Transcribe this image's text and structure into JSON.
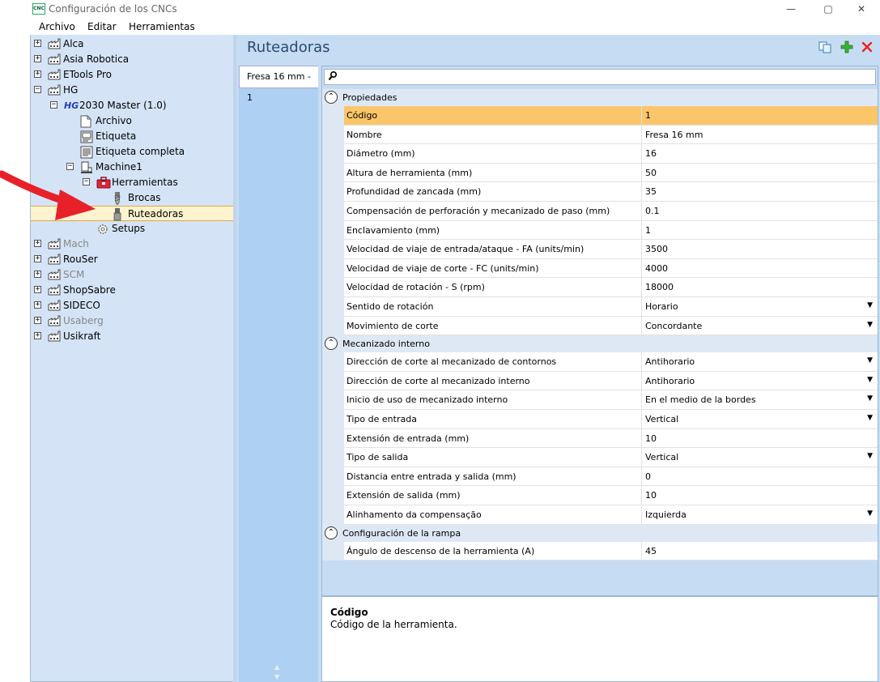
{
  "window": {
    "title": "Configuración de los CNCs",
    "icon_text": "CNC",
    "minimize": "—",
    "maximize": "▢",
    "close": "✕"
  },
  "menu": [
    "Archivo",
    "Editar",
    "Herramientas"
  ],
  "tree": [
    {
      "label": "Alca",
      "level": 0,
      "expander": "+",
      "icon": "factory-icon",
      "dim": false
    },
    {
      "label": "Asia Robotica",
      "level": 0,
      "expander": "+",
      "icon": "factory-icon",
      "dim": false
    },
    {
      "label": "ETools Pro",
      "level": 0,
      "expander": "+",
      "icon": "factory-icon",
      "dim": false
    },
    {
      "label": "HG",
      "level": 0,
      "expander": "−",
      "icon": "factory-icon",
      "dim": false
    },
    {
      "label": "2030 Master (1.0)",
      "level": 1,
      "expander": "−",
      "icon": "hg-logo-icon",
      "dim": false
    },
    {
      "label": "Archivo",
      "level": 2,
      "expander": "",
      "icon": "file-icon",
      "dim": false
    },
    {
      "label": "Etiqueta",
      "level": 2,
      "expander": "",
      "icon": "label-icon",
      "dim": false
    },
    {
      "label": "Etiqueta completa",
      "level": 2,
      "expander": "",
      "icon": "full-label-icon",
      "dim": false
    },
    {
      "label": "Machine1",
      "level": 2,
      "expander": "−",
      "icon": "machine-icon",
      "dim": false
    },
    {
      "label": "Herramientas",
      "level": 3,
      "expander": "−",
      "icon": "toolbox-icon",
      "dim": false
    },
    {
      "label": "Brocas",
      "level": 4,
      "expander": "",
      "icon": "drill-bit-icon",
      "dim": false
    },
    {
      "label": "Ruteadoras",
      "level": 4,
      "expander": "",
      "icon": "router-bit-icon",
      "dim": false,
      "selected": true
    },
    {
      "label": "Setups",
      "level": 3,
      "expander": "",
      "icon": "gear-icon",
      "dim": false
    },
    {
      "label": "Mach",
      "level": 0,
      "expander": "+",
      "icon": "factory-icon",
      "dim": true
    },
    {
      "label": "RouSer",
      "level": 0,
      "expander": "+",
      "icon": "factory-icon",
      "dim": false
    },
    {
      "label": "SCM",
      "level": 0,
      "expander": "+",
      "icon": "factory-icon",
      "dim": true
    },
    {
      "label": "ShopSabre",
      "level": 0,
      "expander": "+",
      "icon": "factory-icon",
      "dim": false
    },
    {
      "label": "SIDECO",
      "level": 0,
      "expander": "+",
      "icon": "factory-icon",
      "dim": false
    },
    {
      "label": "Usaberg",
      "level": 0,
      "expander": "+",
      "icon": "factory-icon",
      "dim": true
    },
    {
      "label": "Usikraft",
      "level": 0,
      "expander": "+",
      "icon": "factory-icon",
      "dim": false
    }
  ],
  "section_title": "Ruteadoras",
  "toolbar_icons": [
    "copy-icon",
    "add-icon",
    "delete-icon"
  ],
  "tab_label": "Fresa 16 mm - 1",
  "categories": [
    {
      "label": "Propiedades",
      "rows": [
        {
          "name": "Código",
          "value": "1",
          "dropdown": false,
          "selected": true
        },
        {
          "name": "Nombre",
          "value": "Fresa 16 mm",
          "dropdown": false
        },
        {
          "name": "Diámetro (mm)",
          "value": "16",
          "dropdown": false
        },
        {
          "name": "Altura de herramienta (mm)",
          "value": "50",
          "dropdown": false
        },
        {
          "name": "Profundidad de zancada (mm)",
          "value": "35",
          "dropdown": false
        },
        {
          "name": "Compensación de perforación y mecanizado de paso (mm)",
          "value": "0.1",
          "dropdown": false
        },
        {
          "name": "Enclavamiento (mm)",
          "value": "1",
          "dropdown": false
        },
        {
          "name": "Velocidad de viaje de entrada/ataque - FA (units/min)",
          "value": "3500",
          "dropdown": false
        },
        {
          "name": "Velocidad de viaje de corte - FC (units/min)",
          "value": "4000",
          "dropdown": false
        },
        {
          "name": "Velocidad de rotación - S (rpm)",
          "value": "18000",
          "dropdown": false
        },
        {
          "name": "Sentido de rotación",
          "value": "Horario",
          "dropdown": true
        },
        {
          "name": "Movimiento de corte",
          "value": "Concordante",
          "dropdown": true
        }
      ]
    },
    {
      "label": "Mecanizado interno",
      "rows": [
        {
          "name": "Dirección de corte al mecanizado de contornos",
          "value": "Antihorario",
          "dropdown": true
        },
        {
          "name": "Dirección de corte al mecanizado interno",
          "value": "Antihorario",
          "dropdown": true
        },
        {
          "name": "Inicio de uso de mecanizado interno",
          "value": "En el medio de la bordes",
          "dropdown": true
        },
        {
          "name": "Tipo de entrada",
          "value": "Vertical",
          "dropdown": true
        },
        {
          "name": "Extensión de entrada (mm)",
          "value": "10",
          "dropdown": false
        },
        {
          "name": "Tipo de salida",
          "value": "Vertical",
          "dropdown": true
        },
        {
          "name": "Distancia entre entrada y salida (mm)",
          "value": "0",
          "dropdown": false
        },
        {
          "name": "Extensión de salida (mm)",
          "value": "10",
          "dropdown": false
        },
        {
          "name": "Alinhamento da compensação",
          "value": "Izquierda",
          "dropdown": true
        }
      ]
    },
    {
      "label": "Configuración de la rampa",
      "rows": [
        {
          "name": "Ángulo de descenso de la herramienta (A)",
          "value": "45",
          "dropdown": false
        }
      ]
    }
  ],
  "description": {
    "title": "Código",
    "text": "Código de la herramienta."
  },
  "colors": {
    "tree_bg": "#d4e4f6",
    "selected_row": "#fbc66a",
    "title_text": "#2a4a6e",
    "annotation_arrow": "#e8202a"
  }
}
